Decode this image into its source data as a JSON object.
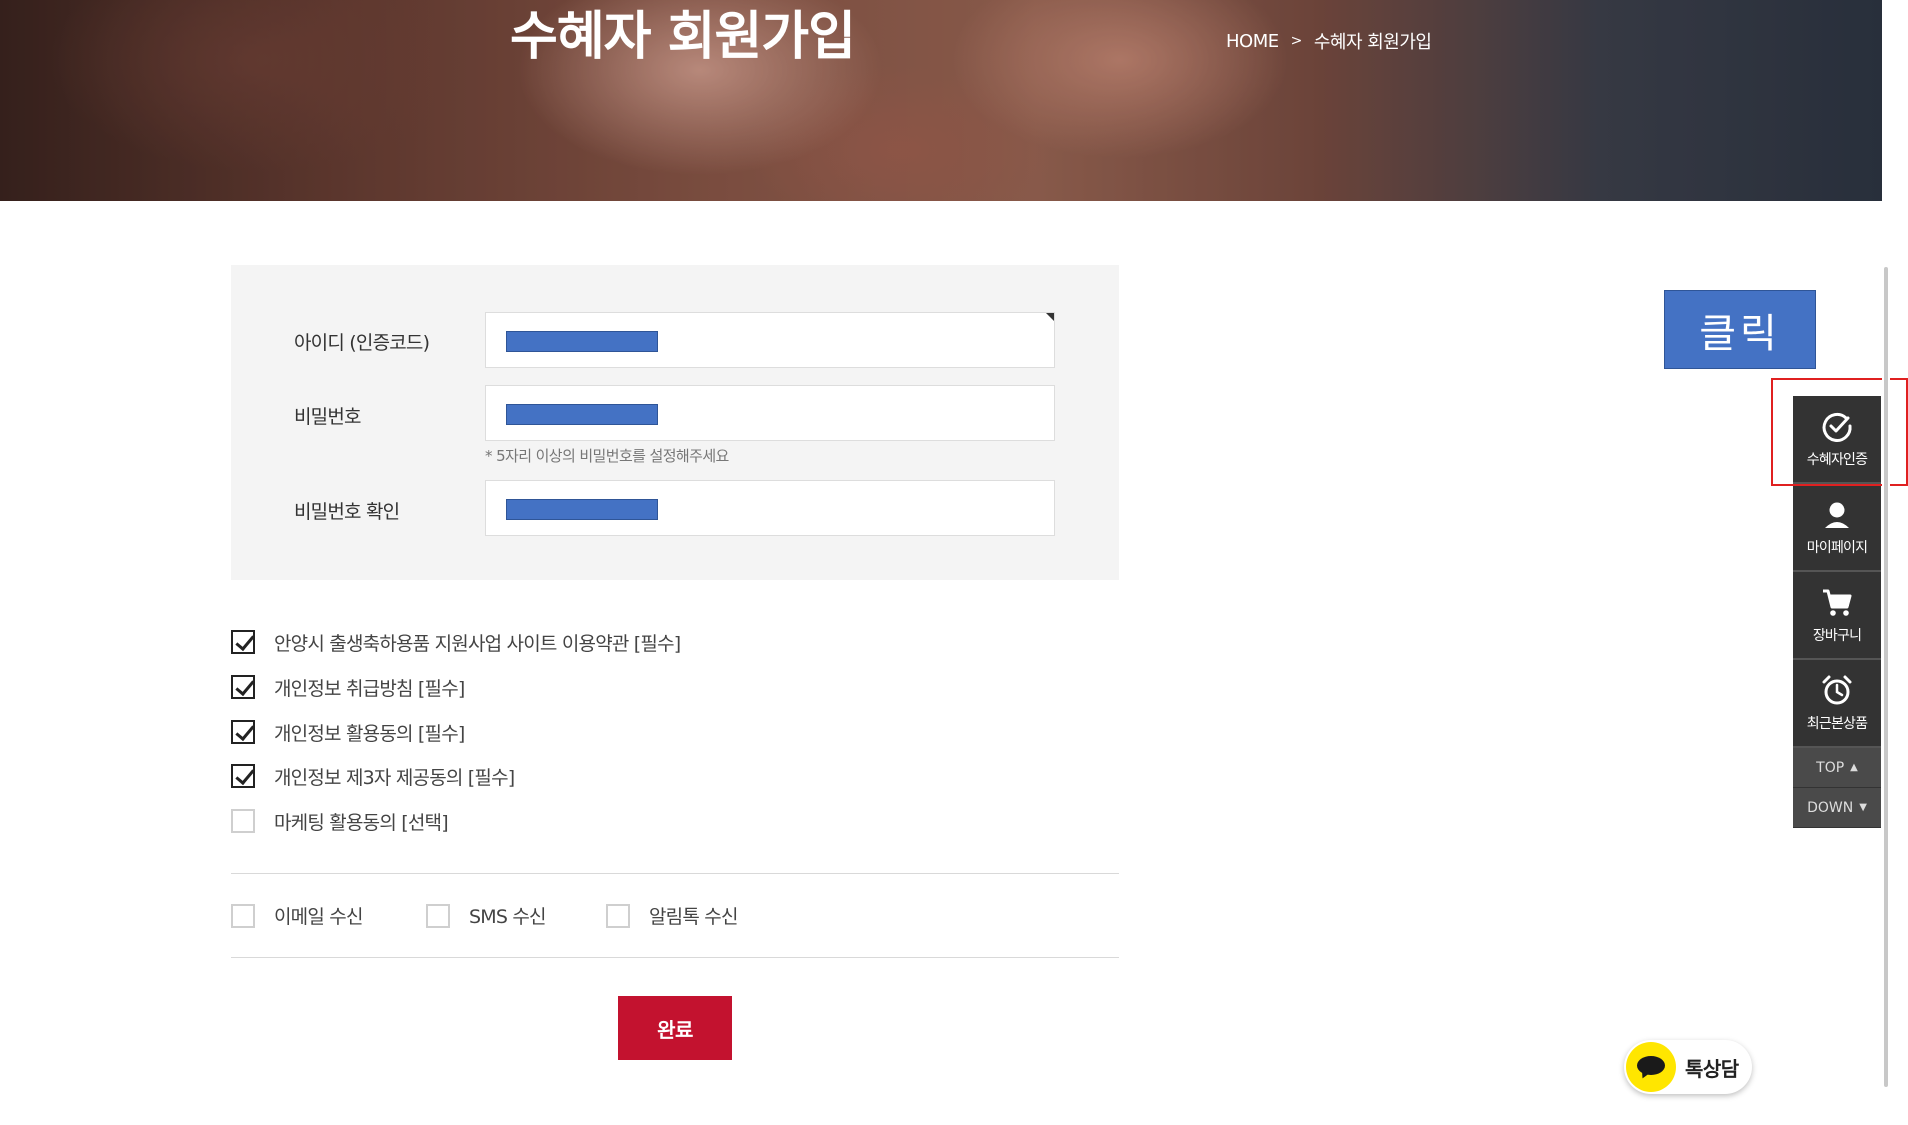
{
  "hero": {
    "title": "수혜자 회원가입",
    "breadcrumb": {
      "home": "HOME",
      "separator": ">",
      "current": "수혜자 회원가입"
    }
  },
  "form": {
    "id_label": "아이디 (인증코드)",
    "password_label": "비밀번호",
    "password_hint": "* 5자리 이상의 비밀번호를 설정해주세요",
    "password_confirm_label": "비밀번호 확인",
    "masked_value_color": "#4472c4"
  },
  "agreements": [
    {
      "label": "안양시 출생축하용품 지원사업 사이트 이용약관 [필수]",
      "checked": true
    },
    {
      "label": "개인정보 취급방침 [필수]",
      "checked": true
    },
    {
      "label": "개인정보 활용동의 [필수]",
      "checked": true
    },
    {
      "label": "개인정보 제3자 제공동의 [필수]",
      "checked": true
    },
    {
      "label": "마케팅 활용동의 [선택]",
      "checked": false
    }
  ],
  "receive_options": [
    {
      "label": "이메일 수신",
      "checked": false
    },
    {
      "label": "SMS 수신",
      "checked": false
    },
    {
      "label": "알림톡 수신",
      "checked": false
    }
  ],
  "submit_label": "완료",
  "click_button": {
    "label": "클릭",
    "color": "#4472c4"
  },
  "quick_menu": {
    "items": [
      {
        "label": "수혜자인증",
        "icon": "check-circle-icon"
      },
      {
        "label": "마이페이지",
        "icon": "user-icon"
      },
      {
        "label": "장바구니",
        "icon": "cart-icon"
      },
      {
        "label": "최근본상품",
        "icon": "alarm-clock-icon"
      }
    ],
    "top_label": "TOP",
    "down_label": "DOWN"
  },
  "talk_button": {
    "label": "톡상담",
    "icon": "kakao-chat-icon"
  },
  "colors": {
    "accent": "#c3122f",
    "quick_menu_bg": "#333333",
    "highlight": "#e02020"
  }
}
